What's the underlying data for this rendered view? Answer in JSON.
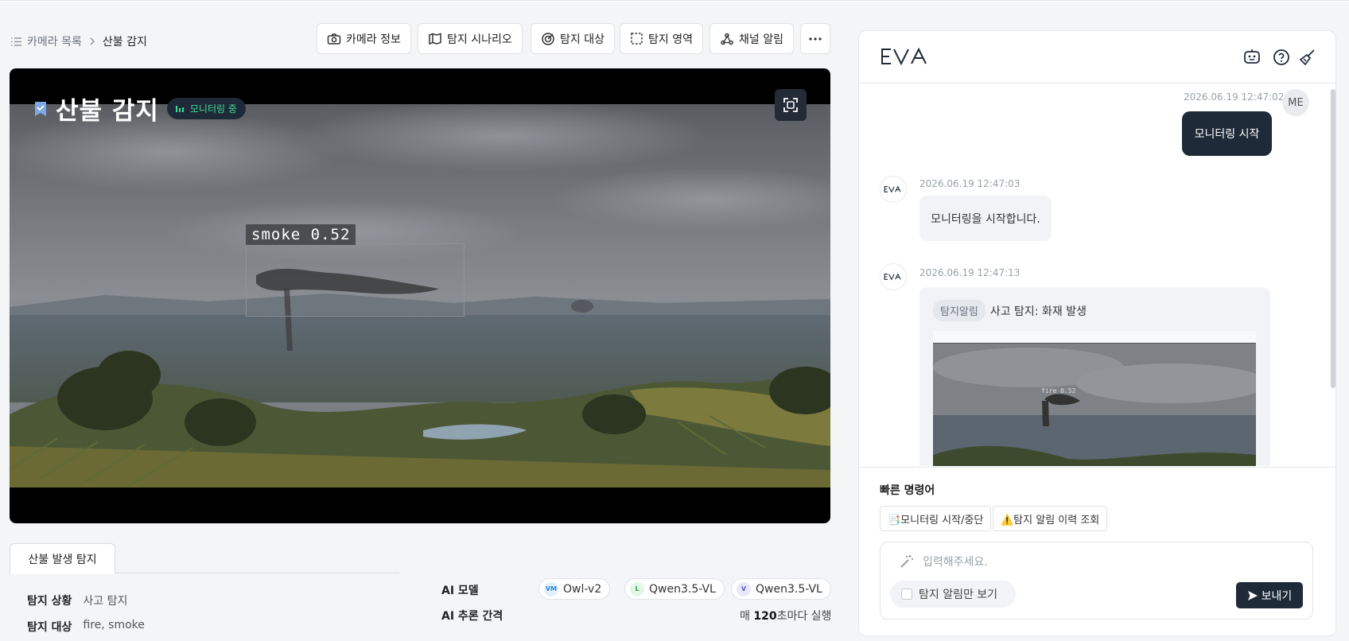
{
  "breadcrumb": {
    "parent": "카메라 목록",
    "current": "산불 감지"
  },
  "toolbar": {
    "camera_info": "카메라 정보",
    "scenario": "탐지 시나리오",
    "target": "탐지 대상",
    "area": "탐지 영역",
    "channel_alert": "채널 알림",
    "more": "more-icon"
  },
  "video": {
    "title": "산불 감지",
    "status_badge": "모니터링 중",
    "detection_label": "smoke  0.52"
  },
  "detail_tab": "산불 발생 탐지",
  "details": {
    "situation_label": "탐지 상황",
    "situation_value": "사고 탐지",
    "target_label": "탐지 대상",
    "target_value": "fire, smoke",
    "ai_model_label": "AI 모델",
    "ai_interval_label": "AI 추론 간격",
    "models": [
      {
        "badge": "VM",
        "name": "Owl-v2",
        "color": "#1e88e5",
        "bg": "#e3f0fc"
      },
      {
        "badge": "L",
        "name": "Qwen3.5-VL",
        "color": "#2e9d4d",
        "bg": "#e4f6e9"
      },
      {
        "badge": "V",
        "name": "Qwen3.5-VL",
        "color": "#5b57d1",
        "bg": "#e9e8fb"
      }
    ],
    "interval_prefix": "매 ",
    "interval_value": "120",
    "interval_suffix": "초마다 실행"
  },
  "chat": {
    "brand": "EVA",
    "messages": [
      {
        "time": "2026.06.19 12:47:02",
        "sender": "ME",
        "text": "모니터링 시작"
      },
      {
        "time": "2026.06.19 12:47:03",
        "sender": "EVA",
        "text": "모니터링을 시작합니다."
      },
      {
        "time": "2026.06.19 12:47:13",
        "sender": "EVA",
        "tag": "탐지알림",
        "text": "사고 탐지: 화재 발생",
        "thumb_label": "fire  0.52"
      }
    ],
    "quick_title": "빠른 명령어",
    "quick_commands": [
      "📑모니터링 시작/중단",
      "⚠️탐지 알림 이력 조회"
    ],
    "input_placeholder": "입력해주세요.",
    "filter_label": "탐지 알림만 보기",
    "send_label": "보내기"
  },
  "colors": {
    "accent": "#1f2a38",
    "status_green": "#3ddc97"
  }
}
